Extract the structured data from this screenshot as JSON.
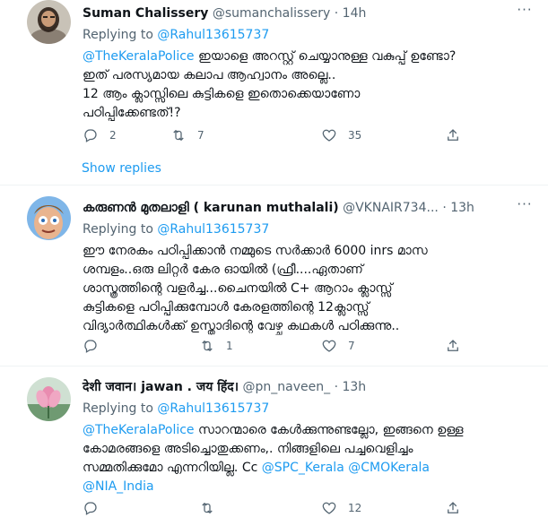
{
  "tweets": [
    {
      "name": "Suman Chalissery",
      "handle": "@sumanchalissery",
      "time": "14h",
      "reply_prefix": "Replying to",
      "reply_to": "@Rahul13615737",
      "mention": "@TheKeralaPolice",
      "text_after_mention": " ഇയാളെ അറസ്റ്റ് ചെയ്യാനുള്ള വകുപ്പ് ഉണ്ടോ?\nഇത് പരസ്യമായ കലാപ ആഹ്വാനം അല്ലെ..\n12 ആം ക്ലാസ്സിലെ കുട്ടികളെ ഇതൊക്കെയാണോ\nപഠിപ്പിക്കേണ്ടത്!?",
      "replies": "2",
      "retweets": "7",
      "likes": "35",
      "show_replies": "Show replies"
    },
    {
      "name": "കരുണൻ മുതലാളി ( karunan muthalali)",
      "handle": "@VKNAIR734...",
      "time": "13h",
      "reply_prefix": "Replying to",
      "reply_to": "@Rahul13615737",
      "text": "ഈ നേരകം പഠിപ്പിക്കാൻ നമ്മുടെ സർക്കാർ  6000 inrs മാസ\nശമ്പളം..ഒരു ലിറ്റർ കേര ഓയിൽ (ഫ്രീ....ഏതാണ്\nശാസ്ത്രത്തിന്റെ വളർച്ച...ചൈനയിൽ C+ ആറാം ക്ലാസ്സ്\nകുട്ടികളെ പഠിപ്പിക്കുമ്പോൾ കേരളത്തിന്റെ 12ക്ലാസ്സ്\nവിദ്യാർത്ഥികൾക്ക് ഉസ്താദിന്റെ വേഴ്ച കഥകൾ പഠിക്കുന്നു..",
      "replies": "",
      "retweets": "1",
      "likes": "7"
    },
    {
      "name": "देशी जवान। jawan . जय हिंद।",
      "handle": "@pn_naveen_",
      "time": "13h",
      "reply_prefix": "Replying to",
      "reply_to": "@Rahul13615737",
      "mention": "@TheKeralaPolice",
      "text_after_mention": " സാറന്മാരെ കേൾക്കുന്നുണ്ടല്ലോ, ഇങ്ങനെ ഉള്ള\nകോമരങ്ങളെ അടിച്ചൊതുക്കണം,. നിങ്ങളിലെ പച്ചവെളിച്ചം\nസമ്മതിക്കുമോ എന്നറിയില്ല. Cc ",
      "cc_1": "@SPC_Kerala",
      "cc_2": "@CMOKerala",
      "cc_3": "@NIA_India",
      "replies": "",
      "retweets": "",
      "likes": "12"
    }
  ],
  "icons": {
    "reply": "reply-icon",
    "retweet": "retweet-icon",
    "like": "heart-icon",
    "share": "share-icon",
    "more": "more-icon"
  },
  "colors": {
    "accent": "#1d9bf0",
    "secondary_text": "#536471",
    "divider": "#eff3f4"
  }
}
